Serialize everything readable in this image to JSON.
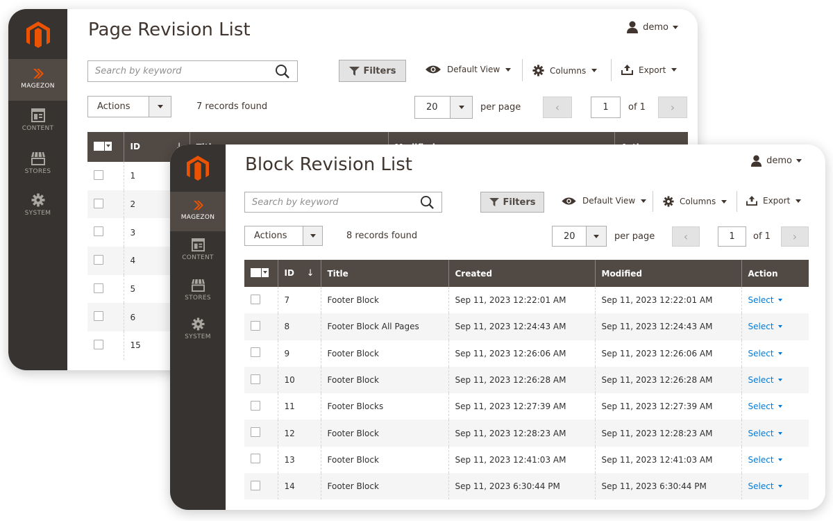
{
  "sidebar": {
    "items": [
      {
        "label": "MAGEZON",
        "icon": "magezon-chevrons-icon"
      },
      {
        "label": "CONTENT",
        "icon": "content-icon"
      },
      {
        "label": "STORES",
        "icon": "stores-icon"
      },
      {
        "label": "SYSTEM",
        "icon": "gear-icon"
      }
    ]
  },
  "user": {
    "name": "demo"
  },
  "toolbar": {
    "search_placeholder": "Search by keyword",
    "filters_label": "Filters",
    "view_label": "Default View",
    "columns_label": "Columns",
    "export_label": "Export",
    "actions_label": "Actions",
    "per_page_value": "20",
    "per_page_label": "per page",
    "page_value": "1",
    "page_of": "of 1"
  },
  "page_window": {
    "title": "Page Revision List",
    "records": "7 records found",
    "columns": [
      "ID",
      "Title",
      "Modified",
      "Action"
    ],
    "ids": [
      "1",
      "2",
      "3",
      "4",
      "5",
      "6",
      "15"
    ]
  },
  "block_window": {
    "title": "Block Revision List",
    "records": "8 records found",
    "columns": [
      "ID",
      "Title",
      "Created",
      "Modified",
      "Action"
    ],
    "select_label": "Select",
    "rows": [
      {
        "id": "7",
        "title": "Footer Block",
        "created": "Sep 11, 2023 12:22:01 AM",
        "modified": "Sep 11, 2023 12:22:01 AM"
      },
      {
        "id": "8",
        "title": "Footer Block All Pages",
        "created": "Sep 11, 2023 12:24:43 AM",
        "modified": "Sep 11, 2023 12:24:43 AM"
      },
      {
        "id": "9",
        "title": "Footer Block",
        "created": "Sep 11, 2023 12:26:06 AM",
        "modified": "Sep 11, 2023 12:26:06 AM"
      },
      {
        "id": "10",
        "title": "Footer Block",
        "created": "Sep 11, 2023 12:26:28 AM",
        "modified": "Sep 11, 2023 12:26:28 AM"
      },
      {
        "id": "11",
        "title": "Footer Blocks",
        "created": "Sep 11, 2023 12:27:39 AM",
        "modified": "Sep 11, 2023 12:27:39 AM"
      },
      {
        "id": "12",
        "title": "Footer Block",
        "created": "Sep 11, 2023 12:28:23 AM",
        "modified": "Sep 11, 2023 12:28:23 AM"
      },
      {
        "id": "13",
        "title": "Footer Block",
        "created": "Sep 11, 2023 12:41:03 AM",
        "modified": "Sep 11, 2023 12:41:03 AM"
      },
      {
        "id": "14",
        "title": "Footer Block",
        "created": "Sep 11, 2023 6:30:44 PM",
        "modified": "Sep 11, 2023 6:30:44 PM"
      }
    ]
  },
  "colors": {
    "sidebar": "#373330",
    "active": "#514943",
    "accent": "#eb5202",
    "link": "#007bdb"
  }
}
